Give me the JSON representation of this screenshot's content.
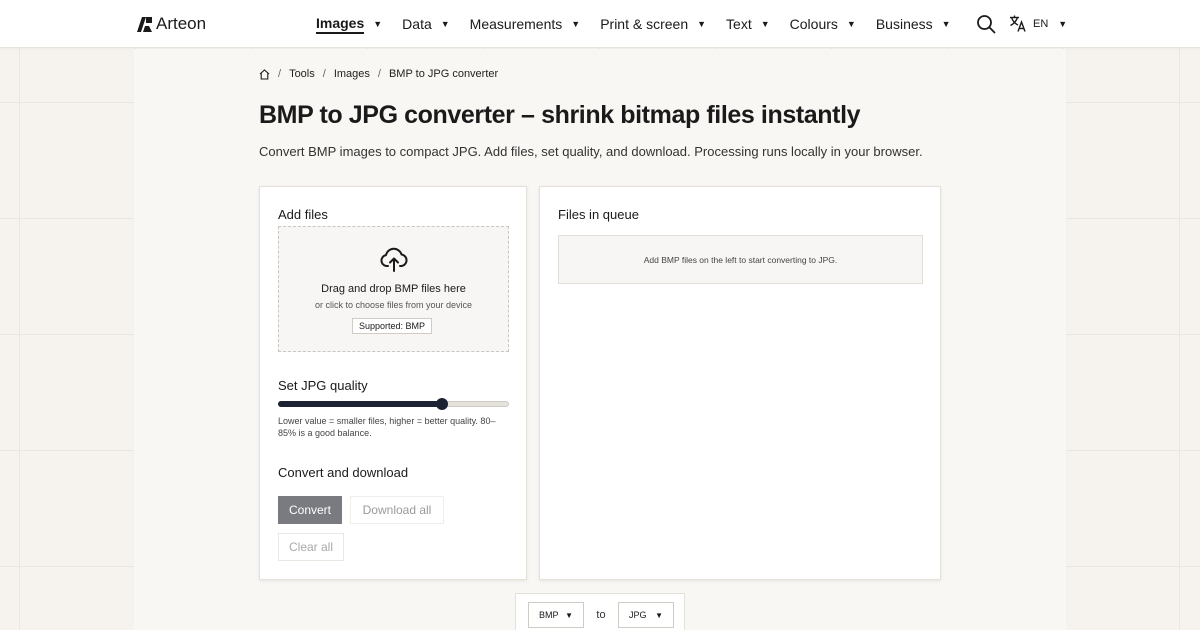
{
  "nav": {
    "brand": "Arteon",
    "menu": [
      {
        "label": "Images",
        "active": true
      },
      {
        "label": "Data",
        "active": false
      },
      {
        "label": "Measurements",
        "active": false
      },
      {
        "label": "Print & screen",
        "active": false
      },
      {
        "label": "Text",
        "active": false
      },
      {
        "label": "Colours",
        "active": false
      },
      {
        "label": "Business",
        "active": false
      }
    ],
    "search_icon": "search-icon",
    "language": {
      "icon": "translate-icon",
      "code": "EN"
    }
  },
  "breadcrumb": {
    "home_icon": "home-icon",
    "items": [
      "Tools",
      "Images",
      "BMP to JPG converter"
    ]
  },
  "page": {
    "title": "BMP to JPG converter – shrink bitmap files instantly",
    "intro": "Convert BMP images to compact JPG. Add files, set quality, and download. Processing runs locally in your browser."
  },
  "left_panel": {
    "add_files_heading": "Add files",
    "dropzone": {
      "icon": "cloud-upload-icon",
      "title": "Drag and drop BMP files here",
      "subtitle": "or click to choose files from your device",
      "supported": "Supported: BMP"
    },
    "quality": {
      "heading": "Set JPG quality",
      "value": 0.71,
      "hint": "Lower value = smaller files, higher = better quality. 80–85% is a good balance."
    },
    "convert_heading": "Convert and download",
    "buttons": {
      "convert": "Convert",
      "download_all": "Download all",
      "clear_all": "Clear all"
    }
  },
  "right_panel": {
    "heading": "Files in queue",
    "empty_message": "Add BMP files on the left to start converting to JPG."
  },
  "format_bar": {
    "from": "BMP",
    "to_label": "to",
    "to": "JPG"
  },
  "colors": {
    "accent_dark": "#1c2232",
    "convert_button": "#7a7b80",
    "background": "#f6f3ef"
  }
}
